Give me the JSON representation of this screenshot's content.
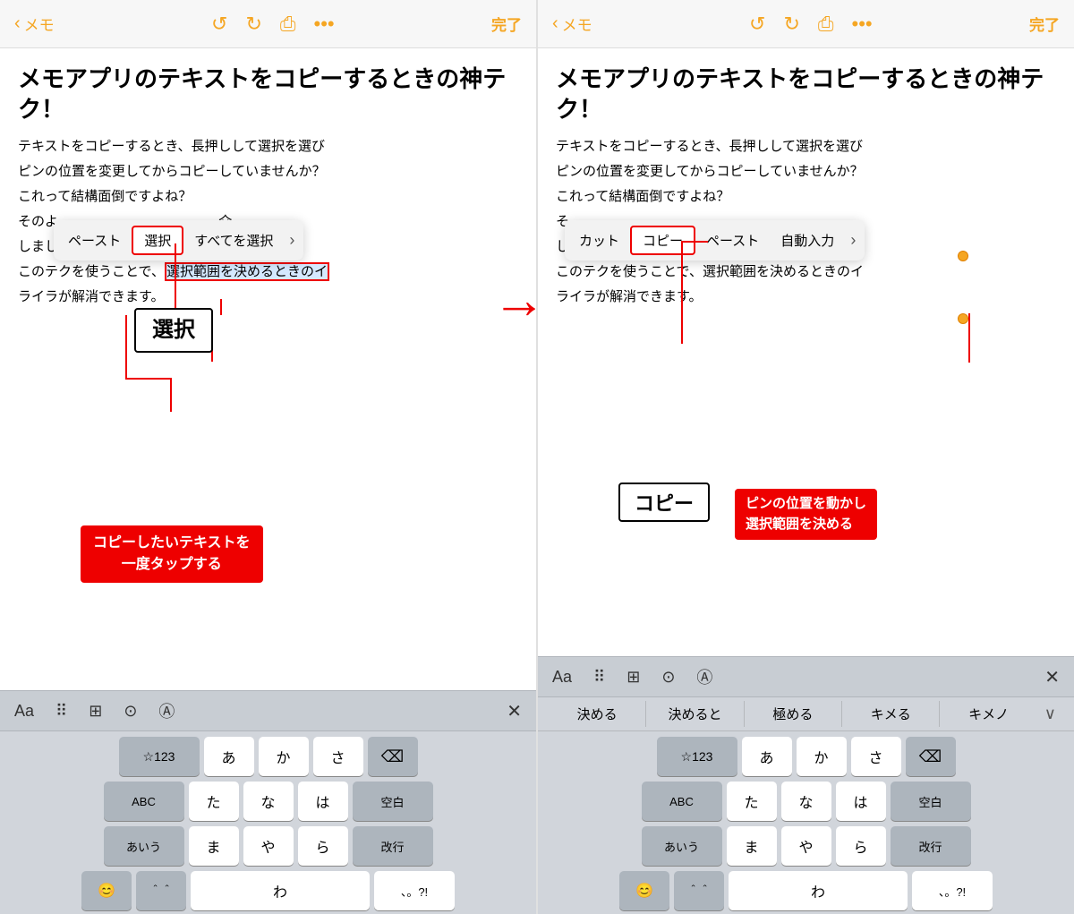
{
  "panel1": {
    "nav": {
      "back_label": "メモ",
      "done_label": "完了"
    },
    "note": {
      "title": "メモアプリのテキストをコピーするときの神テク！",
      "body_lines": [
        "テキストをコピーするとき、長押しして選択を選び",
        "ピンの位置を変更してからコピーしていませんか？",
        "これって結構面倒ですよね？",
        "そのよ",
        "しましょ！",
        "このテクを使うことで、選択範囲を決めるときのイ",
        "ライラが解消できます。"
      ]
    },
    "context_menu": {
      "items": [
        "ペースト",
        "選択",
        "すべてを選択",
        ">"
      ],
      "active": "選択"
    },
    "selected_text": "選択範囲を決めるときのイ",
    "annotation_bordered": "選択",
    "annotation_red": "コピーしたいテキストを\n一度タップする",
    "keyboard": {
      "toolbar_items": [
        "Aa",
        "list",
        "grid",
        "camera",
        "circle-a",
        "×"
      ],
      "rows": [
        [
          "☆123",
          "あ",
          "か",
          "さ",
          "⌫"
        ],
        [
          "ABC",
          "た",
          "な",
          "は",
          "空白"
        ],
        [
          "あいう",
          "ま",
          "や",
          "ら",
          "改行"
        ],
        [
          "😊",
          "＾＾",
          "わ",
          "、。?!"
        ]
      ]
    }
  },
  "panel2": {
    "nav": {
      "back_label": "メモ",
      "done_label": "完了"
    },
    "note": {
      "title": "メモアプリのテキストをコピーするときの神テク！",
      "body_lines": [
        "テキストをコピーするとき、長押しして選択を選び",
        "ピンの位置を変更してからコピーしていませんか？",
        "これって結構面倒ですよね？",
        "そ",
        "しましょ！",
        "このテクを使うことで、選択範囲を決めるときのイ",
        "ライラが解消できます。"
      ]
    },
    "context_menu": {
      "items": [
        "カット",
        "コピー",
        "ペースト",
        "自動入力",
        ">"
      ],
      "active": "コピー"
    },
    "annotation_copy_bordered": "コピー",
    "annotation_pin_red": "ピンの位置を動かし\n選択範囲を決める",
    "keyboard": {
      "toolbar_items": [
        "Aa",
        "list",
        "grid",
        "camera",
        "circle-a",
        "×"
      ],
      "suggestions": [
        "決める",
        "決めると",
        "極める",
        "キメる",
        "キメノ"
      ],
      "rows": [
        [
          "☆123",
          "あ",
          "か",
          "さ",
          "⌫"
        ],
        [
          "ABC",
          "た",
          "な",
          "は",
          "空白"
        ],
        [
          "あいう",
          "ま",
          "や",
          "ら",
          "改行"
        ],
        [
          "😊",
          "＾＾",
          "わ",
          "、。?!"
        ]
      ]
    }
  },
  "arrow": "→"
}
